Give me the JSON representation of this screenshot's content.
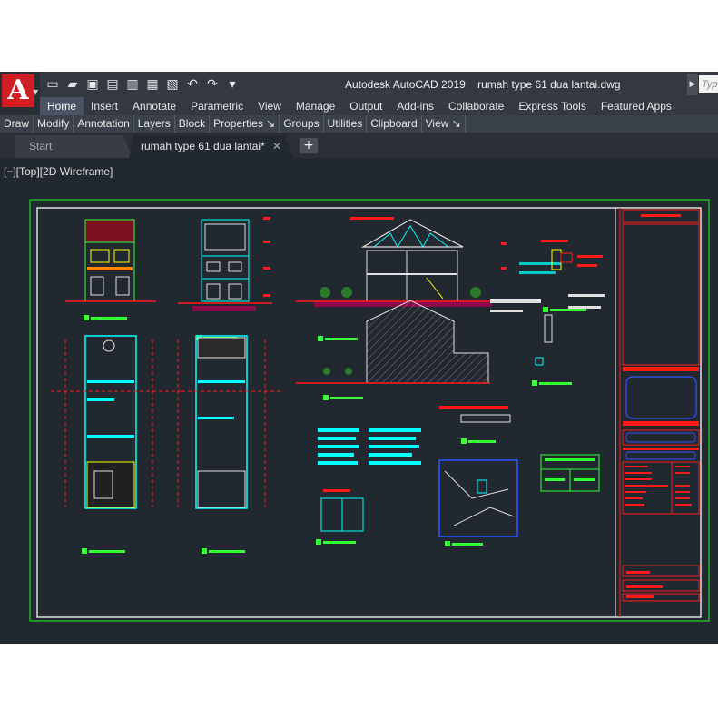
{
  "window": {
    "title": "Autodesk AutoCAD 2019    rumah type 61 dua lantai.dwg",
    "search_placeholder": "Typ",
    "logo_letter": "A"
  },
  "quick_access": [
    {
      "icon": "new-file-icon",
      "glyph": "▭"
    },
    {
      "icon": "open-folder-icon",
      "glyph": "▰"
    },
    {
      "icon": "save-icon",
      "glyph": "▣"
    },
    {
      "icon": "save-as-icon",
      "glyph": "▤"
    },
    {
      "icon": "open-from-web-icon",
      "glyph": "▥"
    },
    {
      "icon": "save-to-web-icon",
      "glyph": "▦"
    },
    {
      "icon": "plot-icon",
      "glyph": "▧"
    },
    {
      "icon": "undo-icon",
      "glyph": "↶"
    },
    {
      "icon": "redo-icon",
      "glyph": "↷"
    },
    {
      "icon": "customize-qat-icon",
      "glyph": "▾"
    }
  ],
  "ribbon_tabs": [
    "Home",
    "Insert",
    "Annotate",
    "Parametric",
    "View",
    "Manage",
    "Output",
    "Add-ins",
    "Collaborate",
    "Express Tools",
    "Featured Apps"
  ],
  "active_ribbon_tab": "Home",
  "panels": [
    "Draw",
    "Modify",
    "Annotation",
    "Layers",
    "Block",
    "Properties ↘",
    "Groups",
    "Utilities",
    "Clipboard",
    "View ↘"
  ],
  "doc_tabs": {
    "start": "Start",
    "current": "rumah type 61 dua lantai*",
    "close_glyph": "✕",
    "new_glyph": "+"
  },
  "viewport_label": "[−][Top][2D Wireframe]",
  "colors": {
    "canvas": "#212830",
    "ribbon": "#333841",
    "sheet_border": "#22d422",
    "cad_cyan": "#00ffff",
    "cad_red": "#ff1a1a",
    "cad_green": "#33ff33",
    "cad_magenta": "#ff33ff",
    "cad_yellow": "#ffff00"
  }
}
